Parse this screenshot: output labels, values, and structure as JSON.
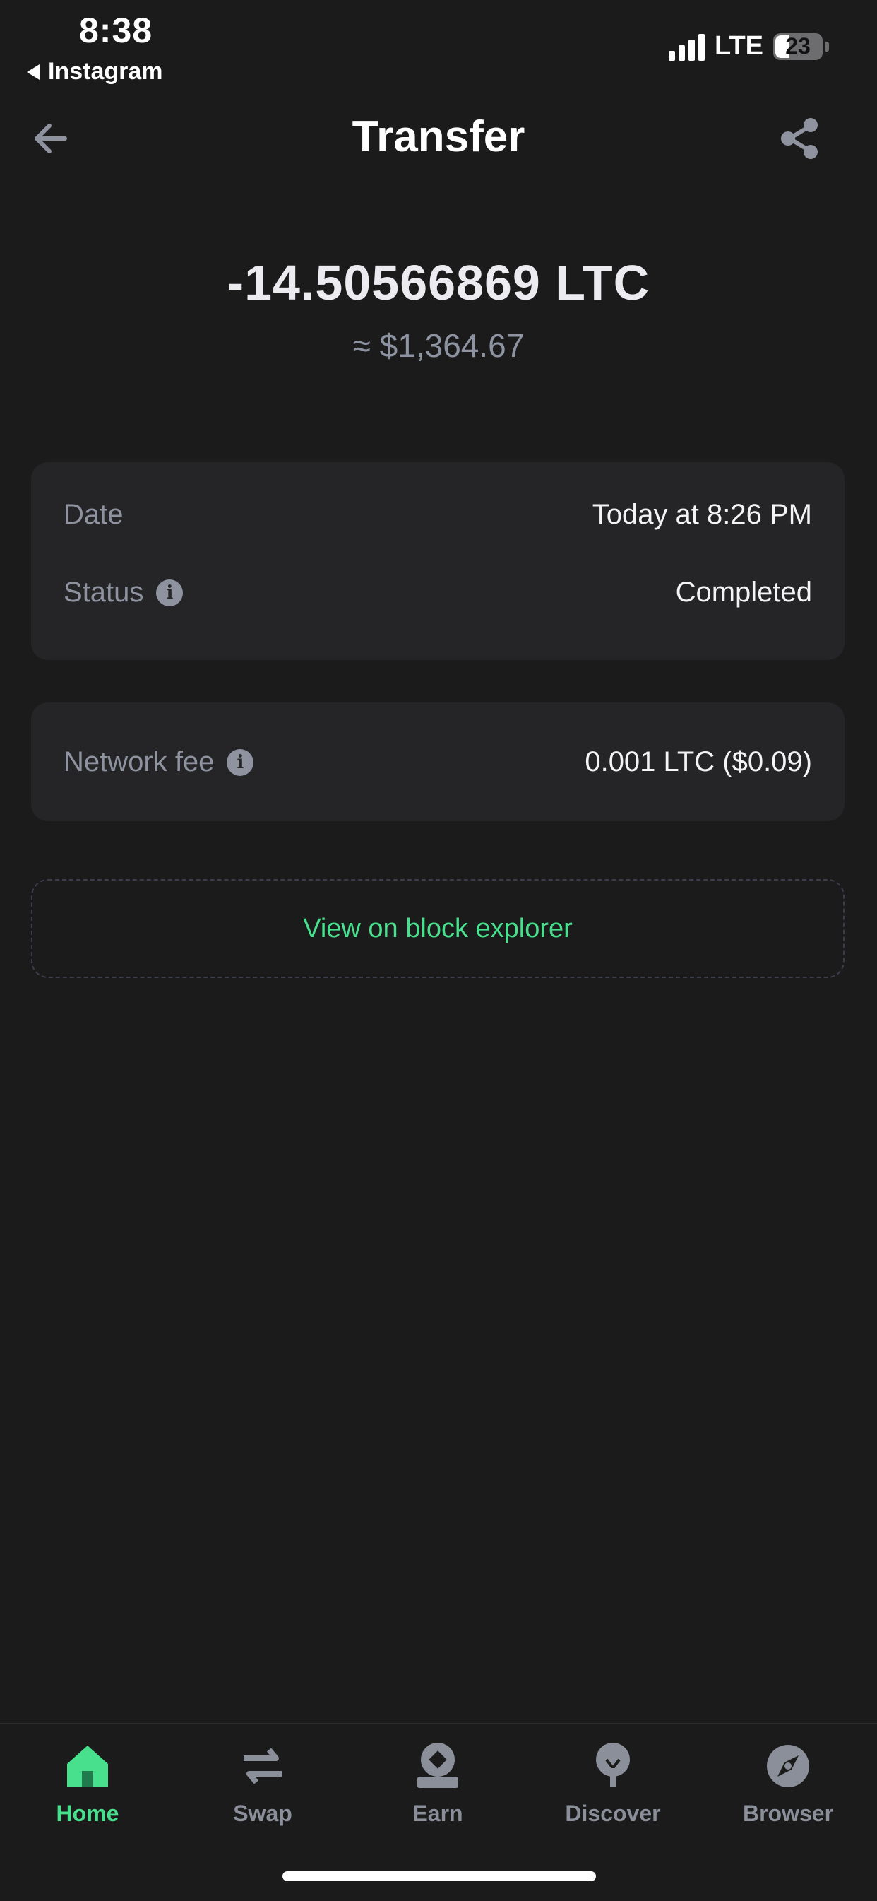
{
  "status_bar": {
    "time": "8:38",
    "back_app": "Instagram",
    "network": "LTE",
    "battery": "23"
  },
  "header": {
    "title": "Transfer"
  },
  "transaction": {
    "amount": "-14.50566869 LTC",
    "fiat_value": "≈ $1,364.67"
  },
  "details": {
    "date_label": "Date",
    "date_value": "Today at 8:26 PM",
    "status_label": "Status",
    "status_value": "Completed"
  },
  "fee": {
    "label": "Network fee",
    "value": "0.001 LTC ($0.09)"
  },
  "explorer_button": {
    "label": "View on block explorer"
  },
  "tabbar": {
    "items": [
      {
        "label": "Home",
        "icon": "home-icon",
        "active": true
      },
      {
        "label": "Swap",
        "icon": "swap-icon",
        "active": false
      },
      {
        "label": "Earn",
        "icon": "earn-icon",
        "active": false
      },
      {
        "label": "Discover",
        "icon": "discover-icon",
        "active": false
      },
      {
        "label": "Browser",
        "icon": "compass-icon",
        "active": false
      }
    ]
  },
  "colors": {
    "background": "#1b1b1c",
    "card": "#252528",
    "accent": "#48e08d",
    "muted": "#8e939f"
  }
}
